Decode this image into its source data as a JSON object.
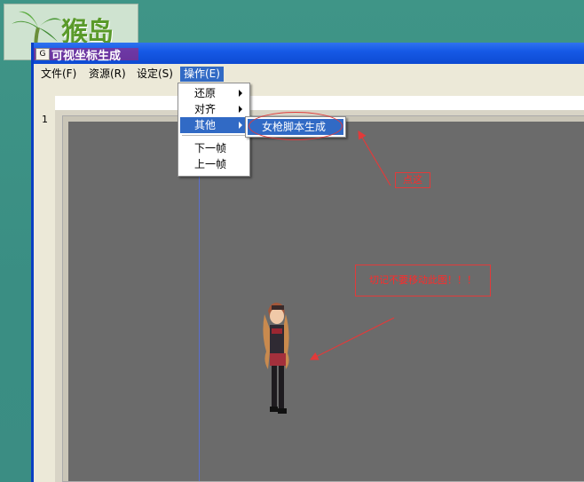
{
  "logo": {
    "text": "猴岛"
  },
  "window": {
    "title": "可视坐标生成",
    "icon_text": "G"
  },
  "menu": {
    "items": [
      "文件(F)",
      "资源(R)",
      "设定(S)",
      "操作(E)"
    ],
    "active_index": 3
  },
  "ruler": {
    "row_label": "1"
  },
  "dropdown": {
    "items": [
      {
        "label": "还原",
        "has_submenu": true
      },
      {
        "label": "对齐",
        "has_submenu": true
      },
      {
        "label": "其他",
        "has_submenu": true,
        "highlighted": true
      },
      {
        "label": "下一帧",
        "has_submenu": false
      },
      {
        "label": "上一帧",
        "has_submenu": false
      }
    ]
  },
  "submenu": {
    "item": "女枪脚本生成"
  },
  "annotations": {
    "click_here": "点这",
    "warning": "切记不要移动此图！！！"
  },
  "colors": {
    "desktop": "#3a8f84",
    "titlebar": "#1659e6",
    "highlight": "#316ac5",
    "canvas": "#6b6b6b",
    "annotation": "#ff2a2a"
  }
}
